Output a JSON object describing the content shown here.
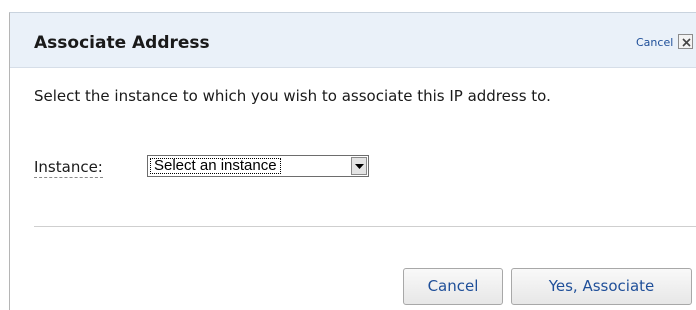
{
  "dialog": {
    "title": "Associate Address",
    "header_cancel_label": "Cancel",
    "message": "Select the instance to which you wish to associate this IP address to.",
    "instance_label": "Instance:",
    "instance_select": {
      "selected": "Select an instance"
    },
    "buttons": {
      "cancel_label": "Cancel",
      "associate_label": "Yes, Associate"
    }
  },
  "icons": {
    "close": "close-icon",
    "dropdown": "chevron-down-icon"
  },
  "colors": {
    "header_background": "#eaf1f9",
    "link": "#1f4f99",
    "button_text": "#1f4f99"
  }
}
